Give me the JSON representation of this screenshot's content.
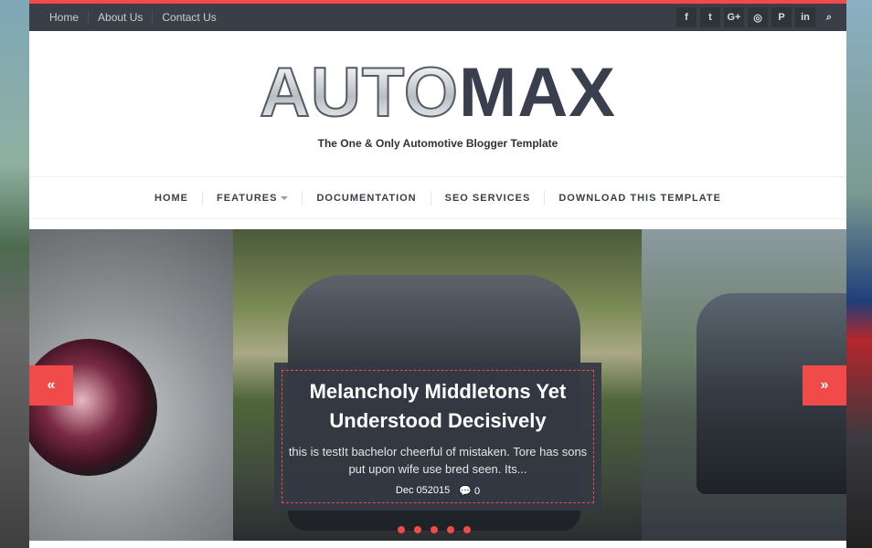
{
  "topbar": {
    "links": [
      "Home",
      "About Us",
      "Contact Us"
    ],
    "social_icons": [
      "facebook-icon",
      "twitter-icon",
      "google-plus-icon",
      "instagram-icon",
      "pinterest-icon",
      "linkedin-icon",
      "search-icon"
    ],
    "social_glyphs": [
      "f",
      "t",
      "G+",
      "◎",
      "P",
      "in",
      "⌕"
    ]
  },
  "logo": {
    "part1": "AUTO",
    "part2": "MAX"
  },
  "tagline": "The One & Only Automotive Blogger Template",
  "nav": {
    "items": [
      "HOME",
      "FEATURES",
      "DOCUMENTATION",
      "SEO SERVICES",
      "DOWNLOAD THIS TEMPLATE"
    ]
  },
  "slider": {
    "prev_glyph": "«",
    "next_glyph": "»",
    "caption": {
      "title": "Melancholy Middletons Yet Understood Decisively",
      "excerpt": "this is testIt bachelor cheerful of mistaken. Tore has sons put upon wife use bred seen. Its...",
      "date": "Dec 052015",
      "comments": "0"
    },
    "dot_count": 5
  },
  "colors": {
    "accent": "#f04a4a",
    "dark": "#3a3f47"
  }
}
